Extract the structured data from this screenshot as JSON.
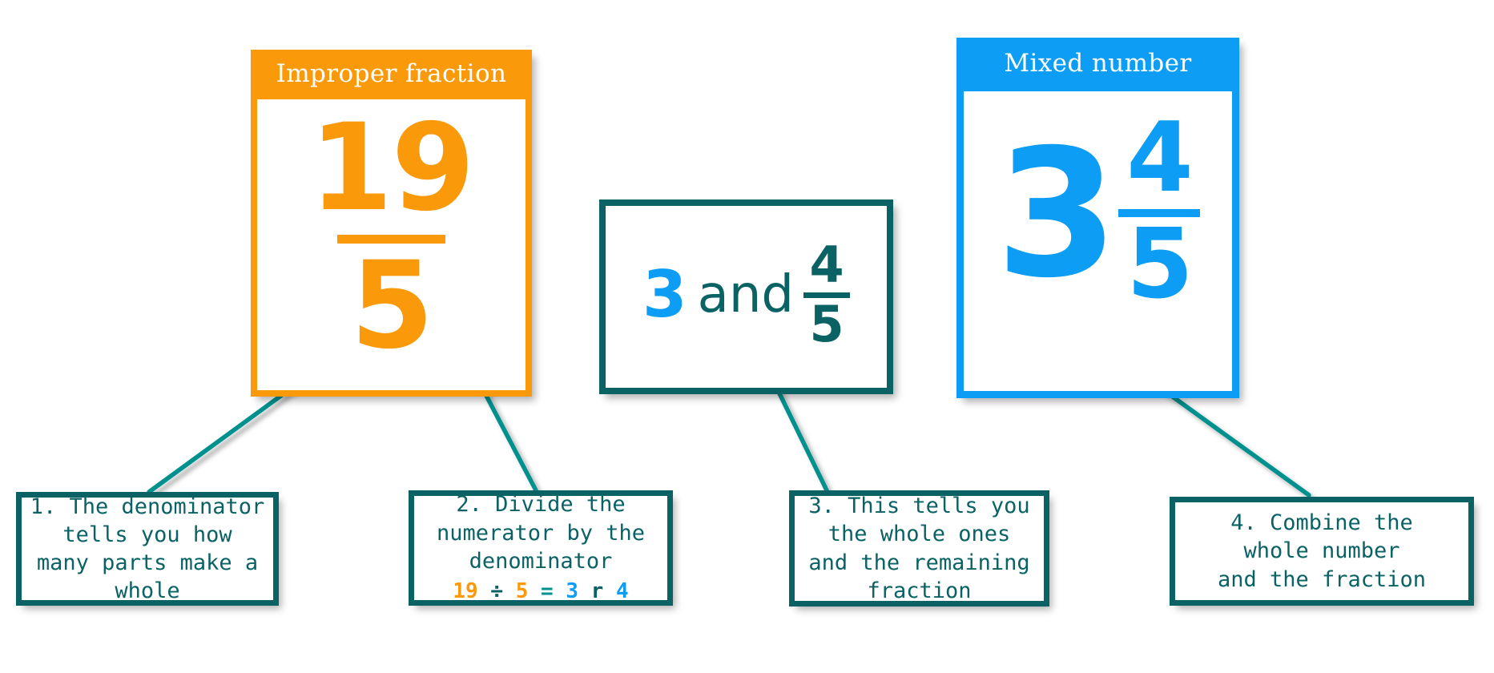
{
  "theme": {
    "orange": "#FA9A0A",
    "blue": "#0D9DF5",
    "teal_arrow": "#00918F",
    "dark_teal": "#0B6265",
    "background": "#FFFFFF"
  },
  "cards": {
    "improper": {
      "title": "Improper fraction",
      "numerator": "19",
      "denominator": "5",
      "color": "#FA9A0A"
    },
    "mixed": {
      "title": "Mixed number",
      "whole": "3",
      "numerator": "4",
      "denominator": "5",
      "color": "#0D9DF5"
    }
  },
  "middle_box": {
    "whole": "3",
    "conjunction": "and",
    "numerator": "4",
    "denominator": "5"
  },
  "captions": [
    {
      "id": "caption-1",
      "lines": [
        "1. The denominator",
        "tells you how",
        "many parts make a",
        "whole"
      ]
    },
    {
      "id": "caption-2",
      "lines": [
        "2. Divide the",
        "numerator by the",
        "denominator"
      ],
      "equation": {
        "dividend": "19",
        "divide_sign": "÷",
        "divisor": "5",
        "equals_sign": "=",
        "quotient": "3",
        "remainder_label": "r",
        "remainder": "4"
      }
    },
    {
      "id": "caption-3",
      "lines": [
        "3. This tells you",
        "the whole ones",
        "and the remaining",
        "fraction"
      ]
    },
    {
      "id": "caption-4",
      "lines": [
        "4. Combine the",
        "whole number",
        "and the fraction"
      ]
    }
  ],
  "arrows": [
    {
      "name": "arrow-denominator",
      "from": "caption-1",
      "to": "improper-denominator"
    },
    {
      "name": "arrow-divide",
      "from": "caption-2",
      "to": "improper-card-right"
    },
    {
      "name": "arrow-whole-ones",
      "from": "caption-3",
      "to": "middle-box"
    },
    {
      "name": "arrow-combine",
      "from": "caption-4",
      "to": "mixed-card"
    }
  ]
}
